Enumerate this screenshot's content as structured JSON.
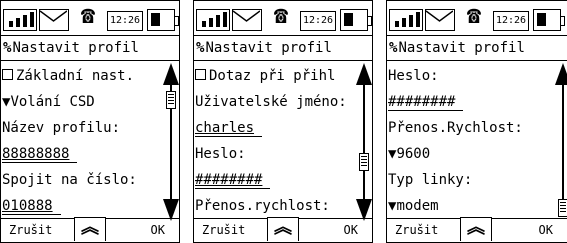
{
  "status": {
    "time": "12:26"
  },
  "title": "Nastavit profil",
  "softkeys": {
    "left": "Zrušit",
    "right": "OK"
  },
  "screens": [
    {
      "rows": [
        "Základní nast.",
        "Volání CSD",
        "Název profilu:",
        "88888888",
        "Spojit na číslo:",
        "010888"
      ]
    },
    {
      "rows": [
        "Dotaz při přihl",
        "Uživatelské jméno:",
        "charles",
        "Heslo:",
        "########",
        "Přenos.rychlost:"
      ]
    },
    {
      "rows": [
        "Heslo:",
        "########",
        "Přenos.Rychlost:",
        "9600",
        "Typ linky:",
        "modem"
      ]
    }
  ]
}
